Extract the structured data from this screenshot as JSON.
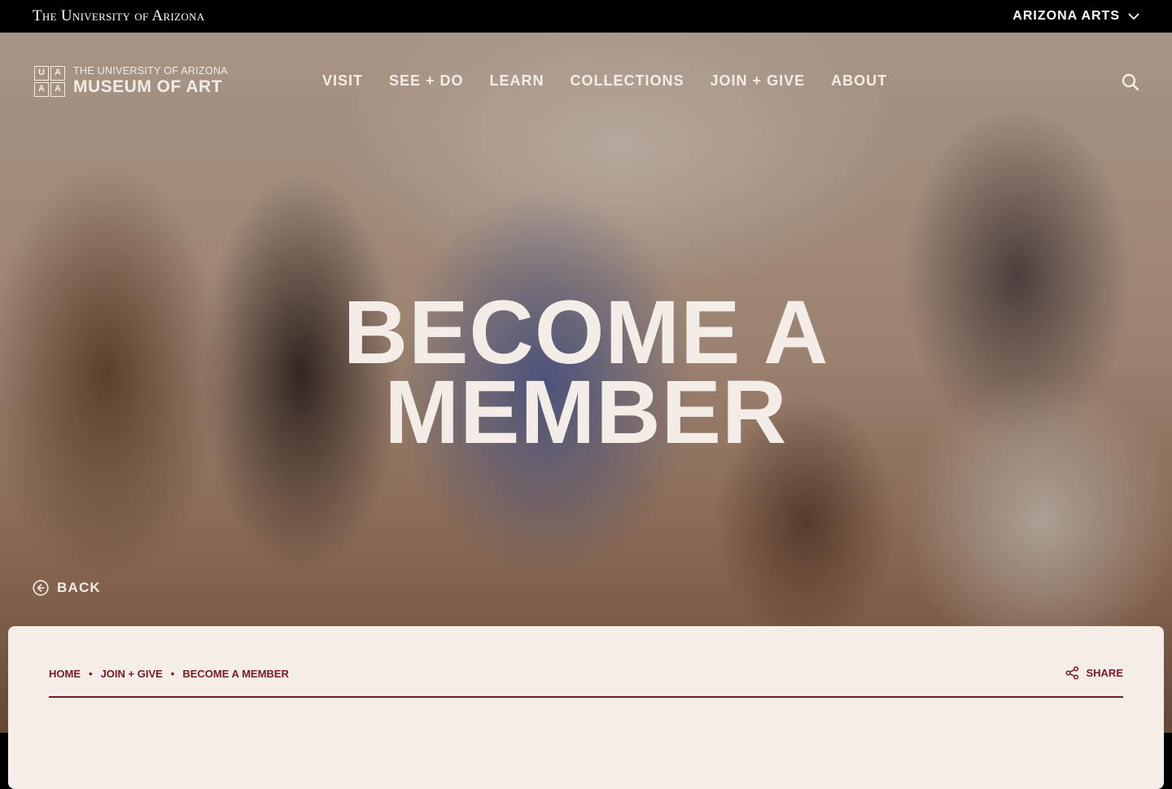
{
  "topbar": {
    "university": "The University of Arizona",
    "arts_menu": "ARIZONA ARTS"
  },
  "logo": {
    "mark": [
      "U",
      "A",
      "A",
      "A"
    ],
    "line1": "THE UNIVERSITY OF ARIZONA",
    "line2": "MUSEUM OF ART"
  },
  "nav": {
    "items": [
      "VISIT",
      "SEE + DO",
      "LEARN",
      "COLLECTIONS",
      "JOIN + GIVE",
      "ABOUT"
    ]
  },
  "hero": {
    "title_line1": "BECOME A",
    "title_line2": "MEMBER",
    "back_label": "BACK"
  },
  "breadcrumb": {
    "items": [
      "HOME",
      "JOIN + GIVE",
      "BECOME A MEMBER"
    ],
    "separator": "•"
  },
  "share_label": "SHARE",
  "icons": {
    "search": "search-icon",
    "chevron": "chevron-down-icon",
    "back": "arrow-left-circle-icon",
    "share": "share-icon"
  },
  "colors": {
    "accent": "#7a1a24",
    "panel": "#f4ede8",
    "hero_text": "#f3ece7"
  }
}
